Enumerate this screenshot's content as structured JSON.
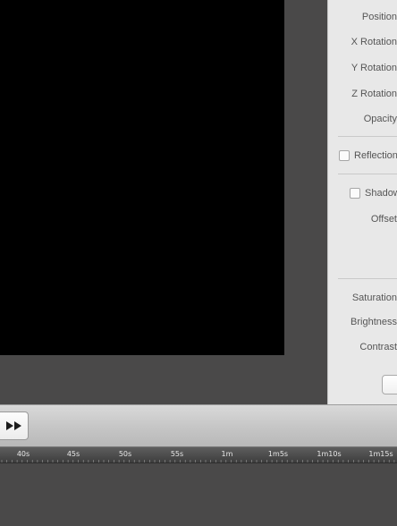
{
  "inspector": {
    "labels": {
      "position": "Position",
      "x_rotation": "X Rotation",
      "y_rotation": "Y Rotation",
      "z_rotation": "Z Rotation",
      "opacity": "Opacity",
      "reflection": "Reflection",
      "shadow": "Shadow",
      "offset": "Offset",
      "saturation": "Saturation",
      "brightness": "Brightness",
      "contrast": "Contrast"
    },
    "reflection_checked": false,
    "shadow_checked": false
  },
  "transport": {
    "fast_forward_icon": "fast-forward-icon"
  },
  "timeline": {
    "ticks": [
      "40s",
      "45s",
      "50s",
      "55s",
      "1m",
      "1m5s",
      "1m10s",
      "1m15s"
    ]
  }
}
